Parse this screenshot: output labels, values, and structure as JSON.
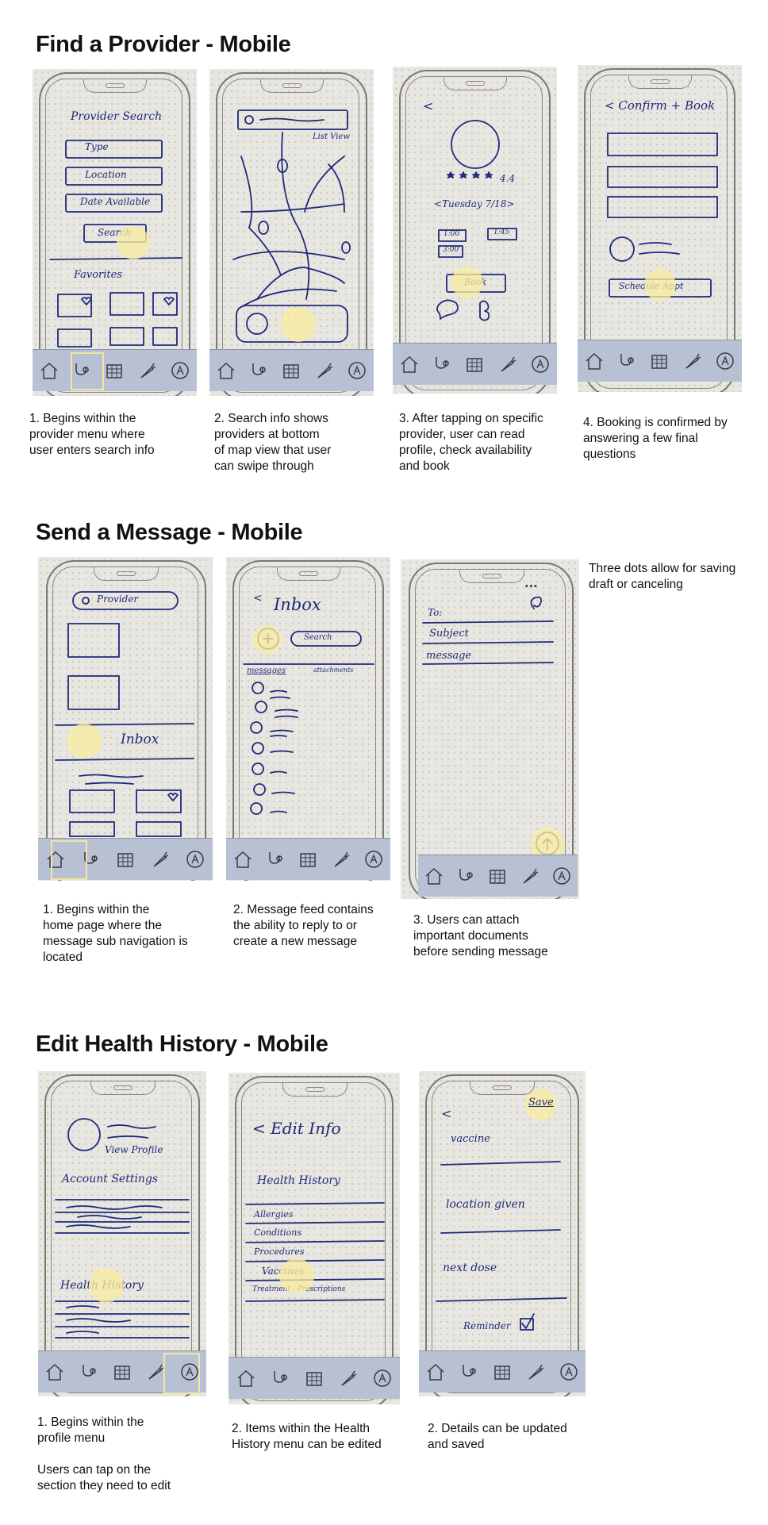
{
  "sections": {
    "find": {
      "title": "Find a Provider - Mobile",
      "captions": [
        "1. Begins within the\nprovider menu where\nuser enters search info",
        "2. Search info shows\nproviders at bottom\nof map view that user\ncan swipe through",
        "3. After tapping on specific\nprovider, user can read\nprofile, check availability\nand book",
        "4. Booking is confirmed by\nanswering a few final\nquestions"
      ],
      "sketch1": {
        "title": "Provider Search",
        "type": "Type",
        "location": "Location",
        "date": "Date Available",
        "search": "Search",
        "favorites": "Favorites"
      },
      "sketch2": {
        "listview": "List View"
      },
      "sketch3": {
        "back": "<",
        "rating": "4.4",
        "date": "<Tuesday 7/18>",
        "slot1": "1:00",
        "slot2": "1:45",
        "slot3": "3:00",
        "book": "Book"
      },
      "sketch4": {
        "header": "< Confirm + Book",
        "schedule": "Schedule Appt"
      }
    },
    "message": {
      "title": "Send a Message - Mobile",
      "captions": [
        "1. Begins within the\nhome page where the\nmessage sub navigation is\nlocated",
        "2. Message feed contains\nthe ability to reply to or\ncreate a new message",
        "3. Users can attach\nimportant documents\nbefore sending message"
      ],
      "note": "Three dots allow for saving\ndraft or canceling",
      "sketch1": {
        "search": "Provider",
        "inbox": "Inbox"
      },
      "sketch2": {
        "back": "<",
        "title": "Inbox",
        "search": "Search",
        "tab1": "messages",
        "tab2": "attachments"
      },
      "sketch3": {
        "dots": "...",
        "to": "To:",
        "subject": "Subject",
        "message": "message"
      }
    },
    "health": {
      "title": "Edit Health History - Mobile",
      "captions": [
        "1. Begins within the\nprofile menu\n\nUsers can tap on the\nsection they need to edit",
        "2. Items within the Health\nHistory menu can be edited",
        "2. Details can be updated\nand saved"
      ],
      "sketch1": {
        "profile": "View Profile",
        "account": "Account Settings",
        "history": "Health History"
      },
      "sketch2": {
        "header": "< Edit Info",
        "history": "Health History",
        "items": [
          "Allergies",
          "Conditions",
          "Procedures",
          "Vaccines",
          "Treatment / Prescriptions"
        ]
      },
      "sketch3": {
        "back": "<",
        "save": "Save",
        "vaccine": "vaccine",
        "location": "location given",
        "dose": "next dose",
        "reminder": "Reminder"
      }
    }
  },
  "tab_icons": [
    "home-icon",
    "stethoscope-icon",
    "calendar-icon",
    "carrot-icon",
    "profile-icon"
  ],
  "colors": {
    "ink": "#1e2a7a",
    "tap_highlight": "#faeca0",
    "tabbar": "#b7c1d3",
    "paper": "#e8e6e0"
  }
}
